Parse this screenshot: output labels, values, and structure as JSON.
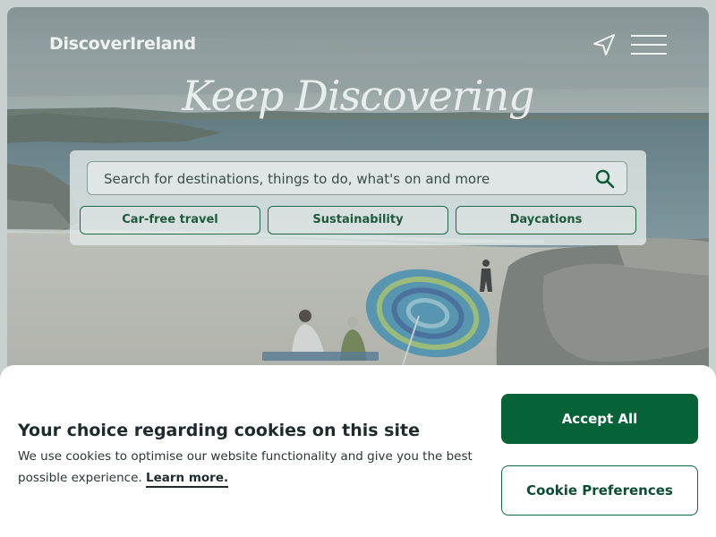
{
  "header": {
    "logo_text": "DiscoverIreland",
    "icons": [
      "send-icon",
      "hamburger-menu-icon"
    ]
  },
  "hero": {
    "tagline": "Keep Discovering"
  },
  "search": {
    "placeholder": "Search for destinations, things to do, what's on and more",
    "icon": "search-icon"
  },
  "chips": [
    {
      "label": "Car-free travel"
    },
    {
      "label": "Sustainability"
    },
    {
      "label": "Daycations"
    }
  ],
  "cookie_banner": {
    "title": "Your choice regarding cookies on this site",
    "body": "We use cookies to optimise our website functionality and give you the best possible experience.",
    "learn_more": "Learn more.",
    "accept_label": "Accept All",
    "preferences_label": "Cookie Preferences"
  },
  "colors": {
    "brand_green": "#066337",
    "chip_text": "#1d5a3c",
    "heading": "#1d2a2e"
  }
}
